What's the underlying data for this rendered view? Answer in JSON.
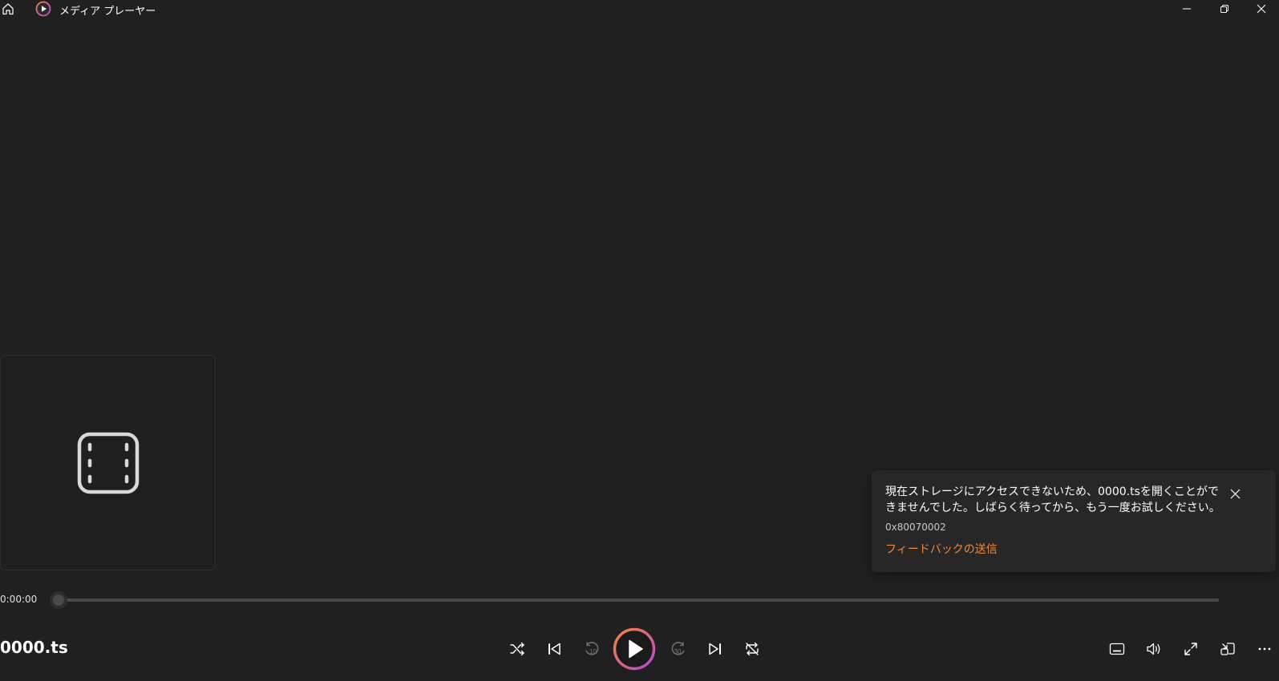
{
  "app": {
    "title": "メディア プレーヤー"
  },
  "notification": {
    "message": "現在ストレージにアクセスできないため、0000.tsを開くことができませんでした。しばらく待ってから、もう一度お試しください。",
    "error_code": "0x80070002",
    "feedback_link": "フィードバックの送信"
  },
  "player": {
    "current_time": "0:00:00",
    "progress": 0,
    "media_title": "0000.ts",
    "skip_back_seconds": "10",
    "skip_forward_seconds": "30"
  },
  "colors": {
    "background": "#202020",
    "accent_orange": "#f0883e",
    "accent_purple": "#b24ad8",
    "toast_bg": "#272727"
  },
  "icons": {
    "home": "home-icon",
    "logo": "media-player-logo",
    "minimize": "minimize-icon",
    "restore": "restore-icon",
    "close": "close-icon",
    "film": "film-icon",
    "shuffle": "shuffle-icon",
    "previous": "previous-icon",
    "skip_back": "skip-back-10-icon",
    "play": "play-icon",
    "skip_forward": "skip-forward-30-icon",
    "next": "next-icon",
    "repeat": "repeat-off-icon",
    "subtitles": "subtitles-icon",
    "volume": "volume-icon",
    "fullscreen": "fullscreen-icon",
    "mini_player": "mini-player-icon",
    "more": "more-icon"
  }
}
